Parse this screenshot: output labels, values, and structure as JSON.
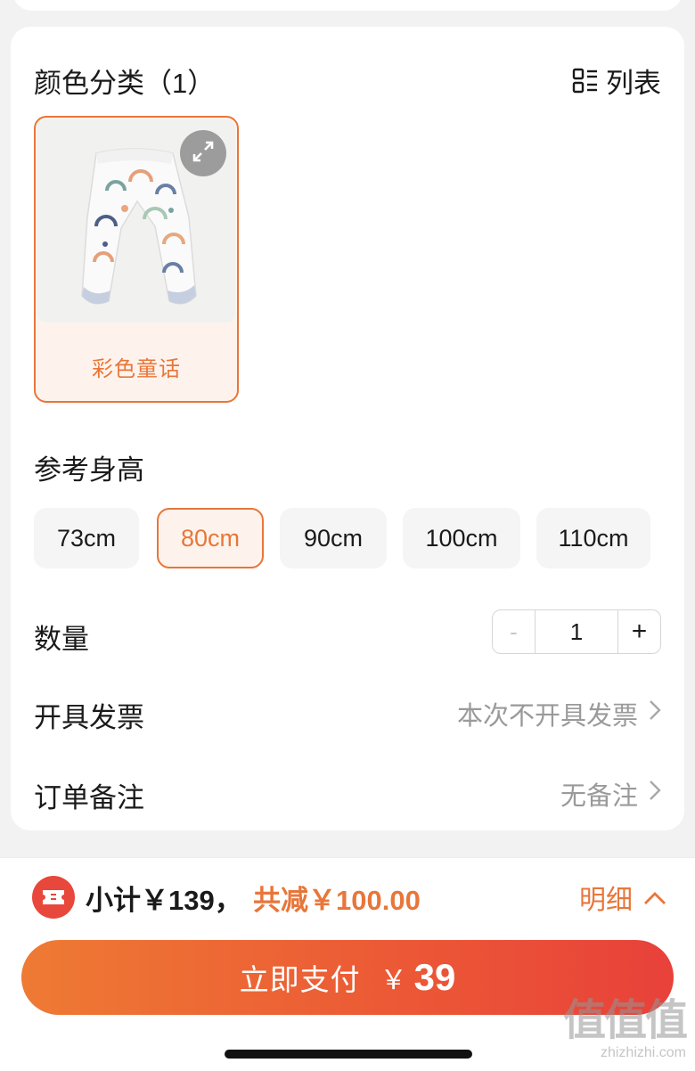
{
  "color_section": {
    "title": "颜色分类（1）",
    "view_toggle_label": "列表",
    "options": [
      {
        "label": "彩色童话",
        "selected": true
      }
    ]
  },
  "size_section": {
    "title": "参考身高",
    "options": [
      {
        "label": "73cm",
        "selected": false
      },
      {
        "label": "80cm",
        "selected": true
      },
      {
        "label": "90cm",
        "selected": false
      },
      {
        "label": "100cm",
        "selected": false
      },
      {
        "label": "110cm",
        "selected": false
      }
    ]
  },
  "quantity": {
    "label": "数量",
    "minus": "-",
    "value": "1",
    "plus": "+"
  },
  "invoice": {
    "label": "开具发票",
    "value": "本次不开具发票"
  },
  "order_note": {
    "label": "订单备注",
    "value": "无备注"
  },
  "summary": {
    "subtotal": "小计￥139，",
    "discount": "共减￥100.00",
    "detail_label": "明细"
  },
  "pay_button": {
    "label": "立即支付",
    "currency": "￥",
    "amount": "39"
  },
  "watermark": {
    "logo": "值值值",
    "site": "zhizhizhi.com"
  },
  "colors": {
    "accent": "#e8763a",
    "pay_gradient_start": "#ee7a34",
    "pay_gradient_end": "#e8413a",
    "coupon_red": "#e8473b"
  }
}
